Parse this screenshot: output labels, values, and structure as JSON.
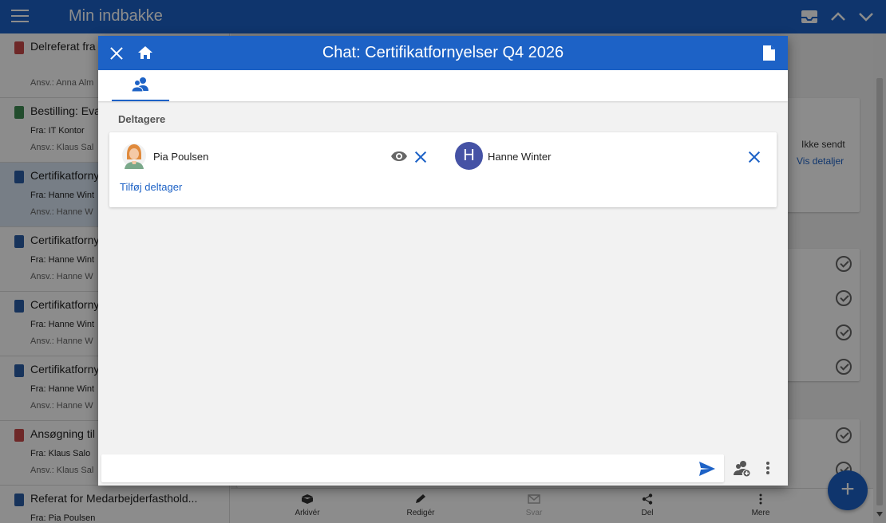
{
  "app": {
    "title": "Min indbakke"
  },
  "inbox": {
    "items": [
      {
        "subject": "Delreferat fra",
        "from": "",
        "responsible": "Ansv.: Anna Alm",
        "color": "#c94a4a",
        "selected": false
      },
      {
        "subject": "Bestilling: Eva",
        "from": "Fra: IT Kontor",
        "responsible": "Ansv.: Klaus Sal",
        "color": "#3f8a52",
        "selected": false
      },
      {
        "subject": "Certifikatforny",
        "from": "Fra: Hanne Wint",
        "responsible": "Ansv.: Hanne W",
        "color": "#2b5ea7",
        "selected": true
      },
      {
        "subject": "Certifikatforny",
        "from": "Fra: Hanne Wint",
        "responsible": "Ansv.: Hanne W",
        "color": "#2b5ea7",
        "selected": false
      },
      {
        "subject": "Certifikatforny",
        "from": "Fra: Hanne Wint",
        "responsible": "Ansv.: Hanne W",
        "color": "#2b5ea7",
        "selected": false
      },
      {
        "subject": "Certifikatforny",
        "from": "Fra: Hanne Wint",
        "responsible": "Ansv.: Hanne W",
        "color": "#2b5ea7",
        "selected": false
      },
      {
        "subject": "Ansøgning til",
        "from": "Fra: Klaus Salo",
        "responsible": "Ansv.: Klaus Sal",
        "color": "#c94a4a",
        "selected": false
      },
      {
        "subject": "Referat for Medarbejderfasthold...",
        "from": "Fra: Pia Poulsen",
        "responsible": "",
        "color": "#2b5ea7",
        "selected": false
      }
    ]
  },
  "details": {
    "status": "Ikke sendt",
    "details_link": "Vis detaljer"
  },
  "bottom_bar": {
    "archive": "Arkivér",
    "edit": "Redigér",
    "reply": "Svar",
    "share": "Del",
    "more": "Mere"
  },
  "fab": {
    "label": "+"
  },
  "dialog": {
    "title": "Chat: Certifikatfornyelser Q4 2026",
    "section_label": "Deltagere",
    "participants": [
      {
        "name": "Pia Poulsen",
        "avatar": "person-photo"
      },
      {
        "name": "Hanne Winter",
        "avatar_letter": "H",
        "avatar_color": "#4552a5"
      }
    ],
    "add_participant": "Tilføj deltager",
    "message_placeholder": ""
  },
  "colors": {
    "brand": "#1d62c6",
    "overlay": "rgba(0,0,0,0.45)"
  }
}
